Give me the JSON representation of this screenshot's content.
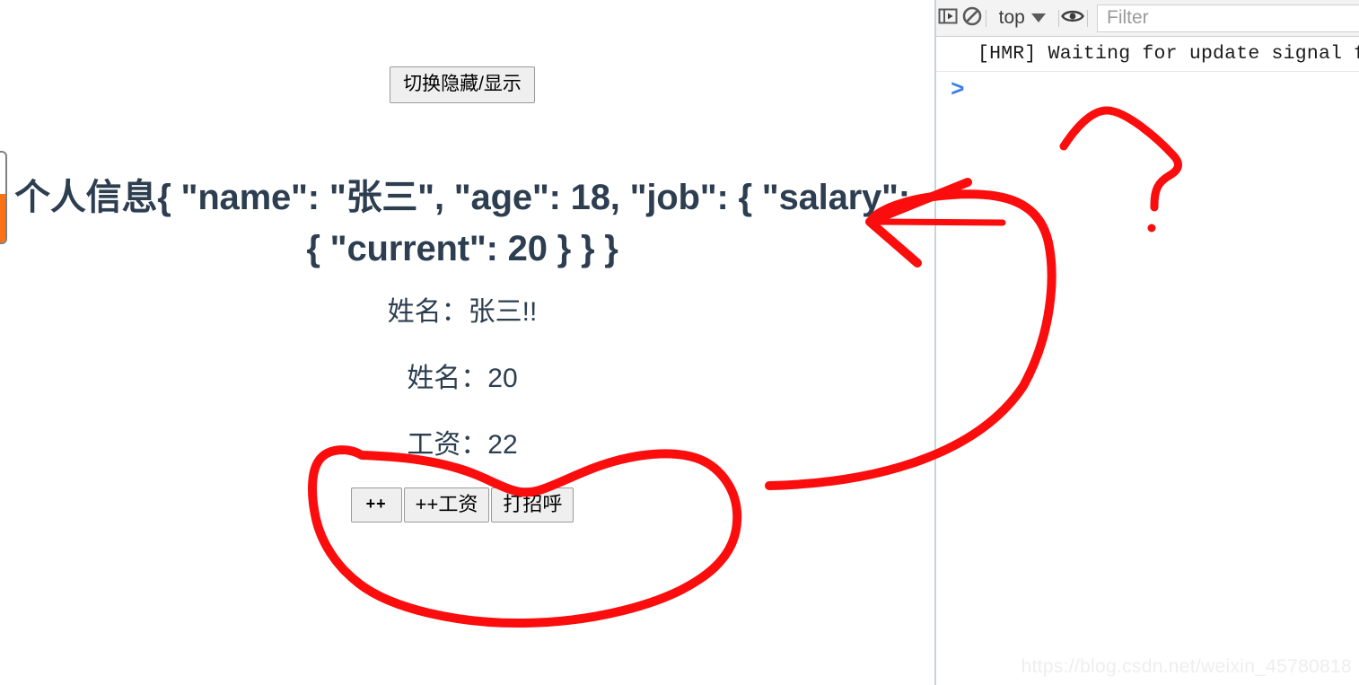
{
  "page": {
    "toggle_button_label": "切换隐藏/显示",
    "heading": "个人信息{ \"name\": \"张三\", \"age\": 18, \"job\": { \"salary\": { \"current\": 20 } } }",
    "lines": [
      {
        "name": "name-line",
        "text": "姓名：张三!!"
      },
      {
        "name": "age-line",
        "text": "姓名：20"
      },
      {
        "name": "wage-line",
        "text": "工资：22"
      }
    ],
    "buttons": [
      {
        "name": "increment-button",
        "label": "++"
      },
      {
        "name": "increment-wage-button",
        "label": "++工资"
      },
      {
        "name": "greet-button",
        "label": "打招呼"
      }
    ],
    "heading_color": "#2c3e50",
    "edge_badge_color": "#f97316"
  },
  "devtools": {
    "toolbar": {
      "sidebar_toggle_icon": "sidebar-toggle-icon",
      "clear_console_icon": "clear-console-icon",
      "context_label": "top",
      "context_caret_icon": "chevron-down-icon",
      "live_expression_icon": "eye-icon",
      "filter_placeholder": "Filter",
      "filter_value": ""
    },
    "messages": [
      {
        "name": "console-message-hmr",
        "text": "[HMR] Waiting for update signal f"
      }
    ],
    "prompt_chevron": ">"
  },
  "annotations": {
    "accent_color": "#fb0d0d",
    "shapes": [
      {
        "name": "arrow-annotation",
        "kind": "curved-arrow-pointing-left"
      },
      {
        "name": "circle-annotation",
        "kind": "hand-drawn-ellipse-around-buttons"
      },
      {
        "name": "question-mark-annotation",
        "kind": "hand-drawn-question-mark"
      }
    ]
  },
  "watermark": {
    "text": "https://blog.csdn.net/weixin_45780818"
  }
}
